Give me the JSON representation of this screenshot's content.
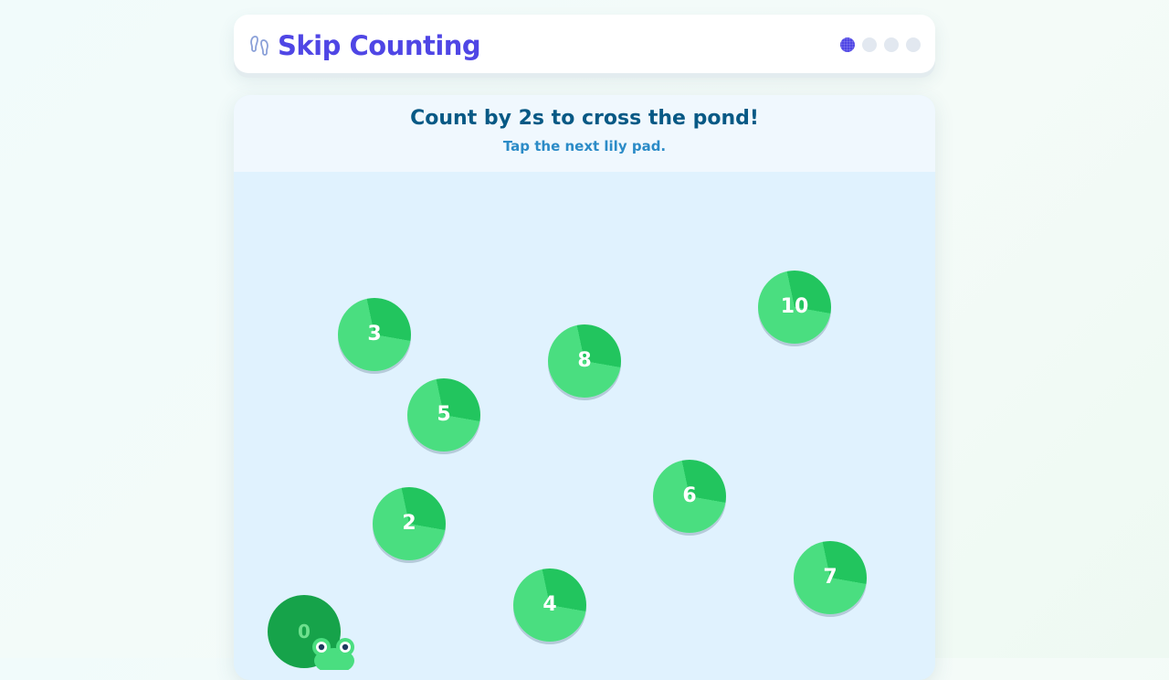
{
  "header": {
    "title": "Skip Counting",
    "logo_icon": "footprints-icon",
    "progress": {
      "total": 4,
      "current": 1
    }
  },
  "game": {
    "instruction": "Count by 2s to cross the pond!",
    "hint": "Tap the next lily pad.",
    "start_pad": {
      "label": "0"
    },
    "pads": [
      {
        "label": "3"
      },
      {
        "label": "8"
      },
      {
        "label": "10"
      },
      {
        "label": "5"
      },
      {
        "label": "6"
      },
      {
        "label": "2"
      },
      {
        "label": "7"
      },
      {
        "label": "4"
      }
    ],
    "character_icon": "frog-icon"
  },
  "colors": {
    "brand": "#4f46e5",
    "pond": "#e0f2fe",
    "pad_dark": "#22c55e",
    "pad_light": "#4ade80",
    "start_pad": "#16a34a",
    "instruction": "#075985",
    "hint": "#2b8bc7"
  }
}
